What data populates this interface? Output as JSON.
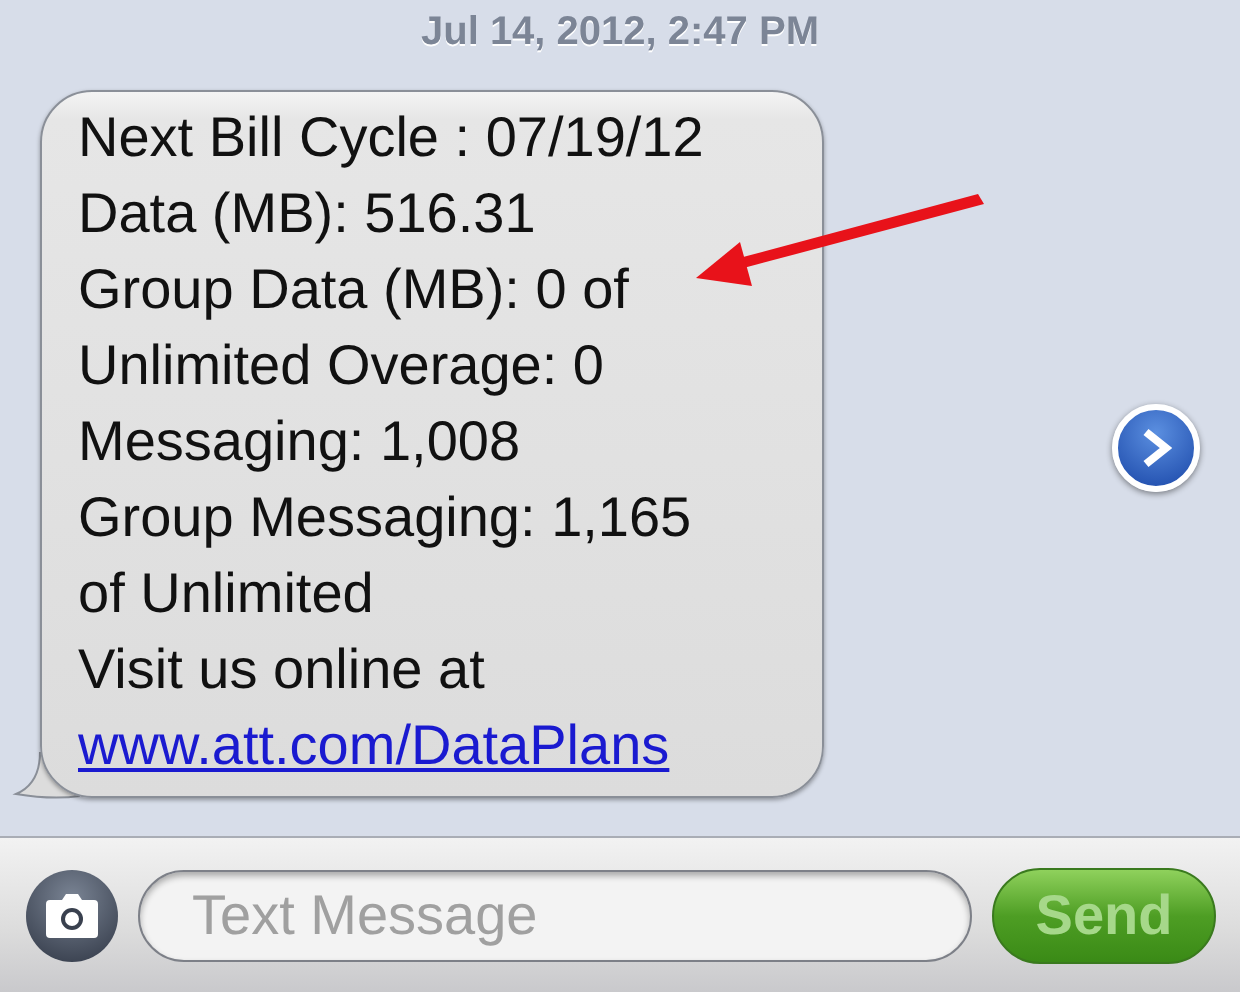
{
  "timestamp": "Jul 14, 2012, 2:47 PM",
  "message": {
    "lines": [
      {
        "kind": "text",
        "text": "Next Bill Cycle : 07/19/12"
      },
      {
        "kind": "text",
        "text": "Data (MB): 516.31"
      },
      {
        "kind": "text",
        "text": "Group Data (MB): 0 of"
      },
      {
        "kind": "text",
        "text": "Unlimited Overage: 0"
      },
      {
        "kind": "text",
        "text": "Messaging: 1,008"
      },
      {
        "kind": "text",
        "text": "Group Messaging: 1,165"
      },
      {
        "kind": "text",
        "text": "of Unlimited"
      },
      {
        "kind": "text",
        "text": "Visit us online at"
      },
      {
        "kind": "link",
        "text": "www.att.com/DataPlans"
      }
    ]
  },
  "input": {
    "placeholder": "Text Message"
  },
  "send_button": {
    "label": "Send",
    "disabled": true
  }
}
